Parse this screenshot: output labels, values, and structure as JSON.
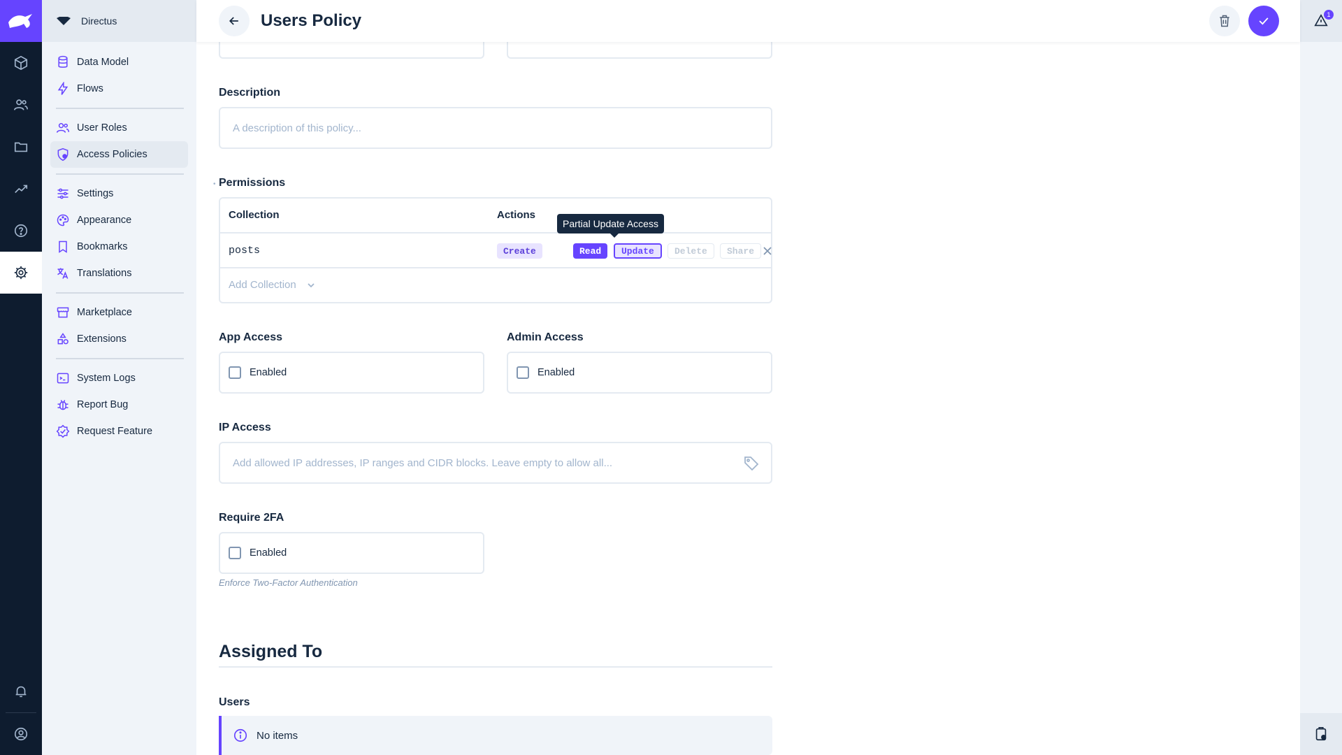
{
  "app": {
    "project_name": "Directus"
  },
  "nav": {
    "items": [
      {
        "label": "Data Model",
        "icon": "database-icon"
      },
      {
        "label": "Flows",
        "icon": "bolt-icon"
      },
      {
        "label": "User Roles",
        "icon": "users-icon"
      },
      {
        "label": "Access Policies",
        "icon": "policy-icon"
      },
      {
        "label": "Settings",
        "icon": "sliders-icon"
      },
      {
        "label": "Appearance",
        "icon": "palette-icon"
      },
      {
        "label": "Bookmarks",
        "icon": "bookmark-icon"
      },
      {
        "label": "Translations",
        "icon": "translate-icon"
      },
      {
        "label": "Marketplace",
        "icon": "store-icon"
      },
      {
        "label": "Extensions",
        "icon": "extensions-icon"
      },
      {
        "label": "System Logs",
        "icon": "terminal-icon"
      },
      {
        "label": "Report Bug",
        "icon": "bug-icon"
      },
      {
        "label": "Request Feature",
        "icon": "feature-icon"
      }
    ]
  },
  "header": {
    "title": "Users Policy"
  },
  "notifications": {
    "count": "1"
  },
  "form": {
    "description": {
      "label": "Description",
      "placeholder": "A description of this policy..."
    },
    "permissions": {
      "label": "Permissions",
      "col_collection": "Collection",
      "col_actions": "Actions",
      "rows": [
        {
          "collection": "posts",
          "create": "Create",
          "read": "Read",
          "update": "Update",
          "delete": "Delete",
          "share": "Share"
        }
      ],
      "add_collection": "Add Collection",
      "tooltip": "Partial Update Access"
    },
    "app_access": {
      "label": "App Access",
      "value": "Enabled"
    },
    "admin_access": {
      "label": "Admin Access",
      "value": "Enabled"
    },
    "ip_access": {
      "label": "IP Access",
      "placeholder": "Add allowed IP addresses, IP ranges and CIDR blocks. Leave empty to allow all..."
    },
    "require_2fa": {
      "label": "Require 2FA",
      "value": "Enabled",
      "hint": "Enforce Two-Factor Authentication"
    },
    "assigned_to": {
      "heading": "Assigned To"
    },
    "users": {
      "label": "Users",
      "empty": "No items"
    }
  },
  "colors": {
    "accent": "#6644ff",
    "module_bar": "#0e1c2f",
    "nav_bg": "#f0f4f9"
  }
}
